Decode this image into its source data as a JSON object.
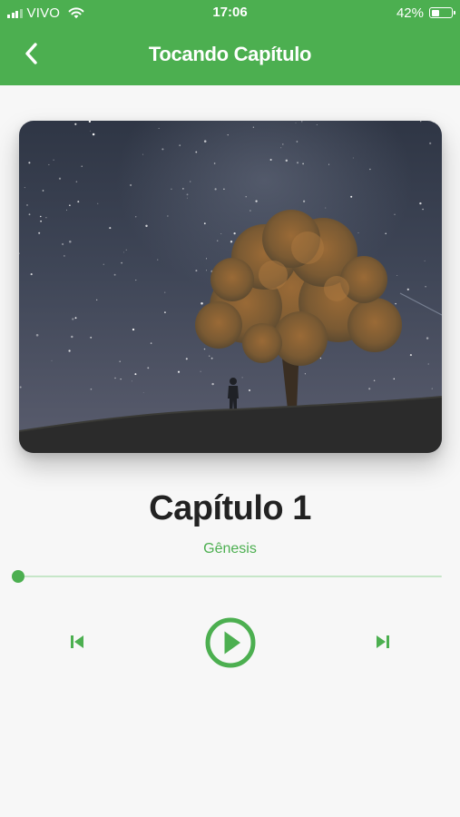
{
  "status_bar": {
    "carrier": "VIVO",
    "time": "17:06",
    "battery_percent": "42%",
    "battery_level": 0.42,
    "signal_bars_active": 3,
    "signal_bars_total": 4
  },
  "nav": {
    "title": "Tocando Capítulo",
    "back_icon": "chevron-left-icon"
  },
  "player": {
    "chapter_title": "Capítulo 1",
    "book_name": "Gênesis",
    "progress": 0.0,
    "controls": {
      "previous_icon": "skip-previous-icon",
      "play_icon": "play-circle-icon",
      "next_icon": "skip-next-icon"
    }
  },
  "colors": {
    "accent": "#4caf50",
    "track": "#c6e6c8",
    "title_text": "#222222",
    "background": "#f7f7f7"
  }
}
